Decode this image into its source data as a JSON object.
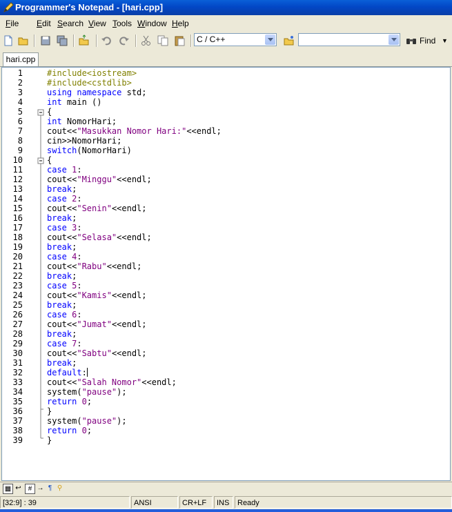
{
  "window": {
    "title": "Programmer's Notepad - [hari.cpp]"
  },
  "menu": [
    {
      "label": "File",
      "key": "F"
    },
    {
      "label": "Edit",
      "key": "E"
    },
    {
      "label": "Search",
      "key": "S"
    },
    {
      "label": "View",
      "key": "V"
    },
    {
      "label": "Tools",
      "key": "T"
    },
    {
      "label": "Window",
      "key": "W"
    },
    {
      "label": "Help",
      "key": "H"
    }
  ],
  "toolbar": {
    "scheme_value": "C / C++",
    "search_value": "",
    "find_label": "Find"
  },
  "tabs": [
    {
      "label": "hari.cpp"
    }
  ],
  "editor": {
    "line_numbers": [
      "1",
      "2",
      "3",
      "4",
      "5",
      "6",
      "7",
      "8",
      "9",
      "10",
      "11",
      "12",
      "13",
      "14",
      "15",
      "16",
      "17",
      "18",
      "19",
      "20",
      "21",
      "22",
      "23",
      "24",
      "25",
      "26",
      "27",
      "28",
      "29",
      "30",
      "31",
      "32",
      "33",
      "34",
      "35",
      "36",
      "37",
      "38",
      "39"
    ],
    "lines": [
      [
        [
          "pp",
          "#include<iostream>"
        ]
      ],
      [
        [
          "pp",
          "#include<cstdlib>"
        ]
      ],
      [
        [
          "kw",
          "using namespace"
        ],
        [
          "tx",
          " std;"
        ]
      ],
      [
        [
          "kw",
          "int"
        ],
        [
          "tx",
          " main ()"
        ]
      ],
      [
        [
          "tx",
          "{"
        ]
      ],
      [
        [
          "kw",
          "int"
        ],
        [
          "tx",
          " NomorHari;"
        ]
      ],
      [
        [
          "tx",
          "cout<<"
        ],
        [
          "st",
          "\"Masukkan Nomor Hari:\""
        ],
        [
          "tx",
          "<<endl;"
        ]
      ],
      [
        [
          "tx",
          "cin>>NomorHari;"
        ]
      ],
      [
        [
          "kw",
          "switch"
        ],
        [
          "tx",
          "(NomorHari)"
        ]
      ],
      [
        [
          "tx",
          "{"
        ]
      ],
      [
        [
          "kw",
          "case"
        ],
        [
          "tx",
          " "
        ],
        [
          "st",
          "1"
        ],
        [
          "tx",
          ":"
        ]
      ],
      [
        [
          "tx",
          "cout<<"
        ],
        [
          "st",
          "\"Minggu\""
        ],
        [
          "tx",
          "<<endl;"
        ]
      ],
      [
        [
          "kw",
          "break"
        ],
        [
          "tx",
          ";"
        ]
      ],
      [
        [
          "kw",
          "case"
        ],
        [
          "tx",
          " "
        ],
        [
          "st",
          "2"
        ],
        [
          "tx",
          ":"
        ]
      ],
      [
        [
          "tx",
          "cout<<"
        ],
        [
          "st",
          "\"Senin\""
        ],
        [
          "tx",
          "<<endl;"
        ]
      ],
      [
        [
          "kw",
          "break"
        ],
        [
          "tx",
          ";"
        ]
      ],
      [
        [
          "kw",
          "case"
        ],
        [
          "tx",
          " "
        ],
        [
          "st",
          "3"
        ],
        [
          "tx",
          ":"
        ]
      ],
      [
        [
          "tx",
          "cout<<"
        ],
        [
          "st",
          "\"Selasa\""
        ],
        [
          "tx",
          "<<endl;"
        ]
      ],
      [
        [
          "kw",
          "break"
        ],
        [
          "tx",
          ";"
        ]
      ],
      [
        [
          "kw",
          "case"
        ],
        [
          "tx",
          " "
        ],
        [
          "st",
          "4"
        ],
        [
          "tx",
          ":"
        ]
      ],
      [
        [
          "tx",
          "cout<<"
        ],
        [
          "st",
          "\"Rabu\""
        ],
        [
          "tx",
          "<<endl;"
        ]
      ],
      [
        [
          "kw",
          "break"
        ],
        [
          "tx",
          ";"
        ]
      ],
      [
        [
          "kw",
          "case"
        ],
        [
          "tx",
          " "
        ],
        [
          "st",
          "5"
        ],
        [
          "tx",
          ":"
        ]
      ],
      [
        [
          "tx",
          "cout<<"
        ],
        [
          "st",
          "\"Kamis\""
        ],
        [
          "tx",
          "<<endl;"
        ]
      ],
      [
        [
          "kw",
          "break"
        ],
        [
          "tx",
          ";"
        ]
      ],
      [
        [
          "kw",
          "case"
        ],
        [
          "tx",
          " "
        ],
        [
          "st",
          "6"
        ],
        [
          "tx",
          ":"
        ]
      ],
      [
        [
          "tx",
          "cout<<"
        ],
        [
          "st",
          "\"Jumat\""
        ],
        [
          "tx",
          "<<endl;"
        ]
      ],
      [
        [
          "kw",
          "break"
        ],
        [
          "tx",
          ";"
        ]
      ],
      [
        [
          "kw",
          "case"
        ],
        [
          "tx",
          " "
        ],
        [
          "st",
          "7"
        ],
        [
          "tx",
          ":"
        ]
      ],
      [
        [
          "tx",
          "cout<<"
        ],
        [
          "st",
          "\"Sabtu\""
        ],
        [
          "tx",
          "<<endl;"
        ]
      ],
      [
        [
          "kw",
          "break"
        ],
        [
          "tx",
          ";"
        ]
      ],
      [
        [
          "kw",
          "default"
        ],
        [
          "tx",
          ":"
        ],
        [
          "caret",
          ""
        ]
      ],
      [
        [
          "tx",
          "cout<<"
        ],
        [
          "st",
          "\"Salah Nomor\""
        ],
        [
          "tx",
          "<<endl;"
        ]
      ],
      [
        [
          "tx",
          "system("
        ],
        [
          "st",
          "\"pause\""
        ],
        [
          "tx",
          ");"
        ]
      ],
      [
        [
          "kw",
          "return"
        ],
        [
          "tx",
          " "
        ],
        [
          "st",
          "0"
        ],
        [
          "tx",
          ";"
        ]
      ],
      [
        [
          "tx",
          "}"
        ]
      ],
      [
        [
          "tx",
          "system("
        ],
        [
          "st",
          "\"pause\""
        ],
        [
          "tx",
          ");"
        ]
      ],
      [
        [
          "kw",
          "return"
        ],
        [
          "tx",
          " "
        ],
        [
          "st",
          "0"
        ],
        [
          "tx",
          ";"
        ]
      ],
      [
        [
          "tx",
          "}"
        ]
      ]
    ]
  },
  "status": {
    "position": "[32:9] : 39",
    "encoding": "ANSI",
    "line_ending": "CR+LF",
    "mode": "INS",
    "state": "Ready"
  },
  "colors": {
    "keyword": "#0000ff",
    "preprocessor": "#808000",
    "string": "#800080",
    "titlebar": "#0247c6"
  }
}
